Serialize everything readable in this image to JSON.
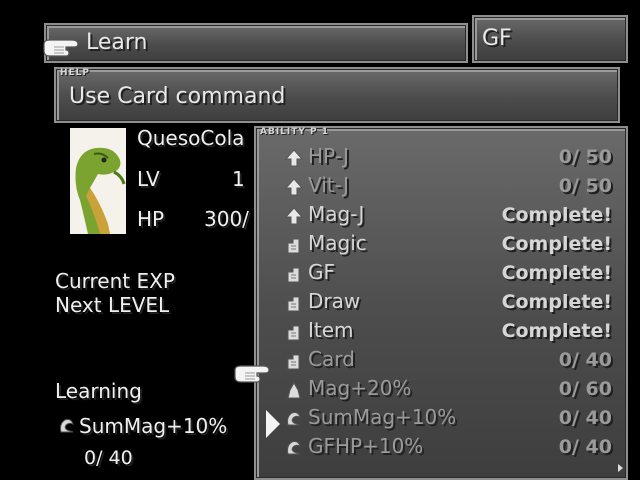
{
  "menu": {
    "title": "Learn",
    "gf_label": "GF"
  },
  "help": {
    "header": "HELP",
    "text": "Use Card command"
  },
  "character": {
    "name": "QuesoCola",
    "lv_label": "LV",
    "lv_value": "1",
    "hp_label": "HP",
    "hp_value": "300/"
  },
  "exp": {
    "current_label": "Current EXP",
    "next_label": "Next LEVEL"
  },
  "learning": {
    "label": "Learning",
    "ability": "SumMag+10%",
    "progress": "0/ 40"
  },
  "ability_list": {
    "header": "ABILITY P 1",
    "items": [
      {
        "name": "HP-J",
        "value": "0/ 50",
        "icon": "arrow-up-icon",
        "state": "dim"
      },
      {
        "name": "Vit-J",
        "value": "0/ 50",
        "icon": "arrow-up-icon",
        "state": "dim"
      },
      {
        "name": "Mag-J",
        "value": "Complete!",
        "icon": "arrow-up-icon",
        "state": "lit"
      },
      {
        "name": "Magic",
        "value": "Complete!",
        "icon": "command-icon",
        "state": "lit"
      },
      {
        "name": "GF",
        "value": "Complete!",
        "icon": "command-icon",
        "state": "lit"
      },
      {
        "name": "Draw",
        "value": "Complete!",
        "icon": "command-icon",
        "state": "lit"
      },
      {
        "name": "Item",
        "value": "Complete!",
        "icon": "command-icon",
        "state": "lit"
      },
      {
        "name": "Card",
        "value": "0/ 40",
        "icon": "command-icon",
        "state": "dim"
      },
      {
        "name": "Mag+20%",
        "value": "0/ 60",
        "icon": "stat-icon",
        "state": "dim"
      },
      {
        "name": "SumMag+10%",
        "value": "0/ 40",
        "icon": "gf-ability-icon",
        "state": "dim"
      },
      {
        "name": "GFHP+10%",
        "value": "0/ 40",
        "icon": "gf-ability-icon",
        "state": "dim"
      }
    ]
  },
  "colors": {
    "panel_top": "#6a6a6a",
    "panel_bottom": "#3e3e3e",
    "text": "#e8e8e8",
    "dim_text": "#9a9a9a"
  }
}
